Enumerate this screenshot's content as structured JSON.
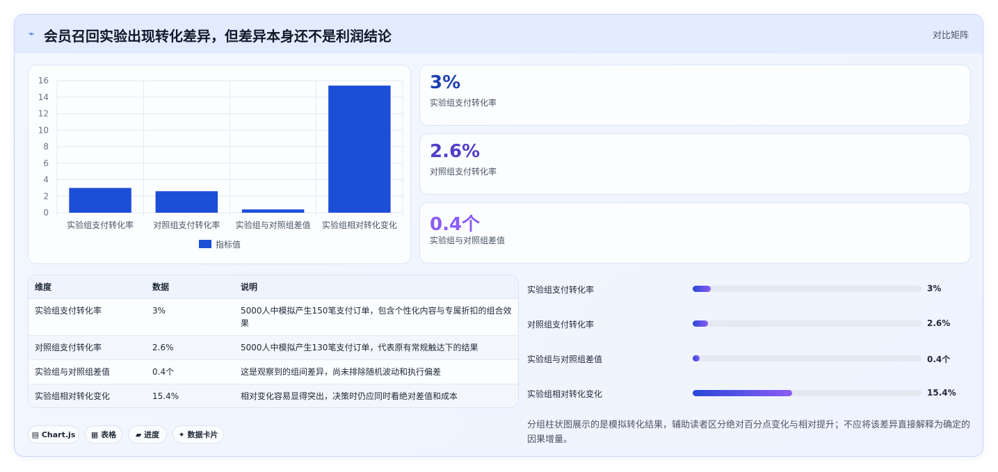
{
  "header": {
    "title": "会员召回实验出现转化差异，但差异本身还不是利润结论",
    "tag": "对比矩阵",
    "icon": "⌁"
  },
  "chart_data": {
    "type": "bar",
    "categories": [
      "实验组支付转化率",
      "对照组支付转化率",
      "实验组与对照组差值",
      "实验组相对转化变化"
    ],
    "series": [
      {
        "name": "指标值",
        "values": [
          3,
          2.6,
          0.4,
          15.4
        ],
        "color": "#1d4ed8"
      }
    ],
    "yticks": [
      "0",
      "2",
      "4",
      "6",
      "8",
      "10",
      "12",
      "14",
      "16"
    ],
    "ylim": [
      0,
      16
    ],
    "legend": "bottom",
    "grid": true
  },
  "kpis": [
    {
      "value": "3%",
      "label": "实验组支付转化率",
      "color": "#1e40af"
    },
    {
      "value": "2.6%",
      "label": "对照组支付转化率",
      "color": "#5040c8"
    },
    {
      "value": "0.4个",
      "label": "实验组与对照组差值",
      "color": "#8b5cf6"
    }
  ],
  "table": {
    "headers": [
      "维度",
      "数据",
      "说明"
    ],
    "rows": [
      [
        "实验组支付转化率",
        "3%",
        "5000人中模拟产生150笔支付订单，包含个性化内容与专属折扣的组合效果"
      ],
      [
        "对照组支付转化率",
        "2.6%",
        "5000人中模拟产生130笔支付订单，代表原有常规触达下的结果"
      ],
      [
        "实验组与对照组差值",
        "0.4个",
        "这是观察到的组间差异，尚未排除随机波动和执行偏差"
      ],
      [
        "实验组相对转化变化",
        "15.4%",
        "相对变化容易显得突出，决策时仍应同时看绝对差值和成本"
      ]
    ]
  },
  "progress": [
    {
      "label": "实验组支付转化率",
      "value": "3%",
      "fraction": 0.078
    },
    {
      "label": "对照组支付转化率",
      "value": "2.6%",
      "fraction": 0.068
    },
    {
      "label": "实验组与对照组差值",
      "value": "0.4个",
      "fraction": 0.03
    },
    {
      "label": "实验组相对转化变化",
      "value": "15.4%",
      "fraction": 0.435
    }
  ],
  "chips": [
    {
      "icon": "▤",
      "label": "Chart.js"
    },
    {
      "icon": "▦",
      "label": "表格"
    },
    {
      "icon": "▰",
      "label": "进度"
    },
    {
      "icon": "✦",
      "label": "数据卡片"
    }
  ],
  "note": "分组柱状图展示的是模拟转化结果，辅助读者区分绝对百分点变化与相对提升；不应将该差异直接解释为确定的因果增量。"
}
